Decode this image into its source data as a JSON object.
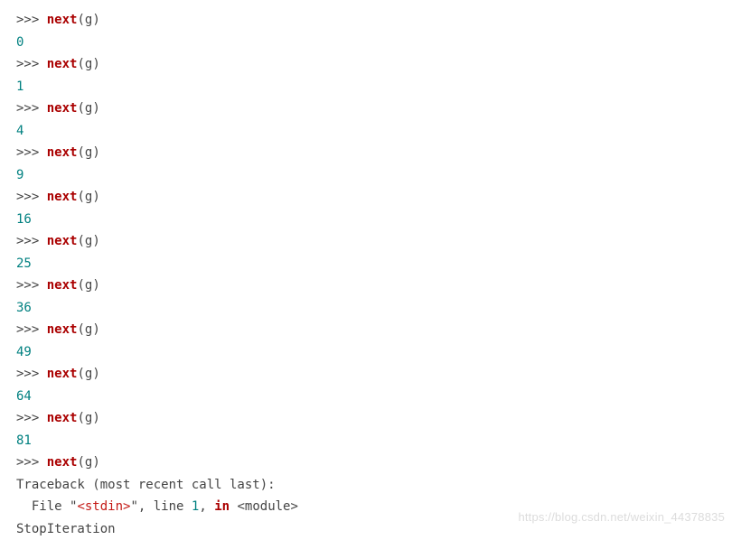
{
  "repl": {
    "prompt": ">>>",
    "call_kw": "next",
    "arg": "g",
    "outputs": [
      "0",
      "1",
      "4",
      "9",
      "16",
      "25",
      "36",
      "49",
      "64",
      "81"
    ],
    "traceback": {
      "header": "Traceback (most recent call last):",
      "file_prefix": "  File \"",
      "file_name": "<stdin>",
      "file_mid": "\", line ",
      "line_no": "1",
      "file_mid2": ", ",
      "in_kw": "in",
      "module": " <module>",
      "error": "StopIteration"
    }
  },
  "watermark": "https://blog.csdn.net/weixin_44378835"
}
